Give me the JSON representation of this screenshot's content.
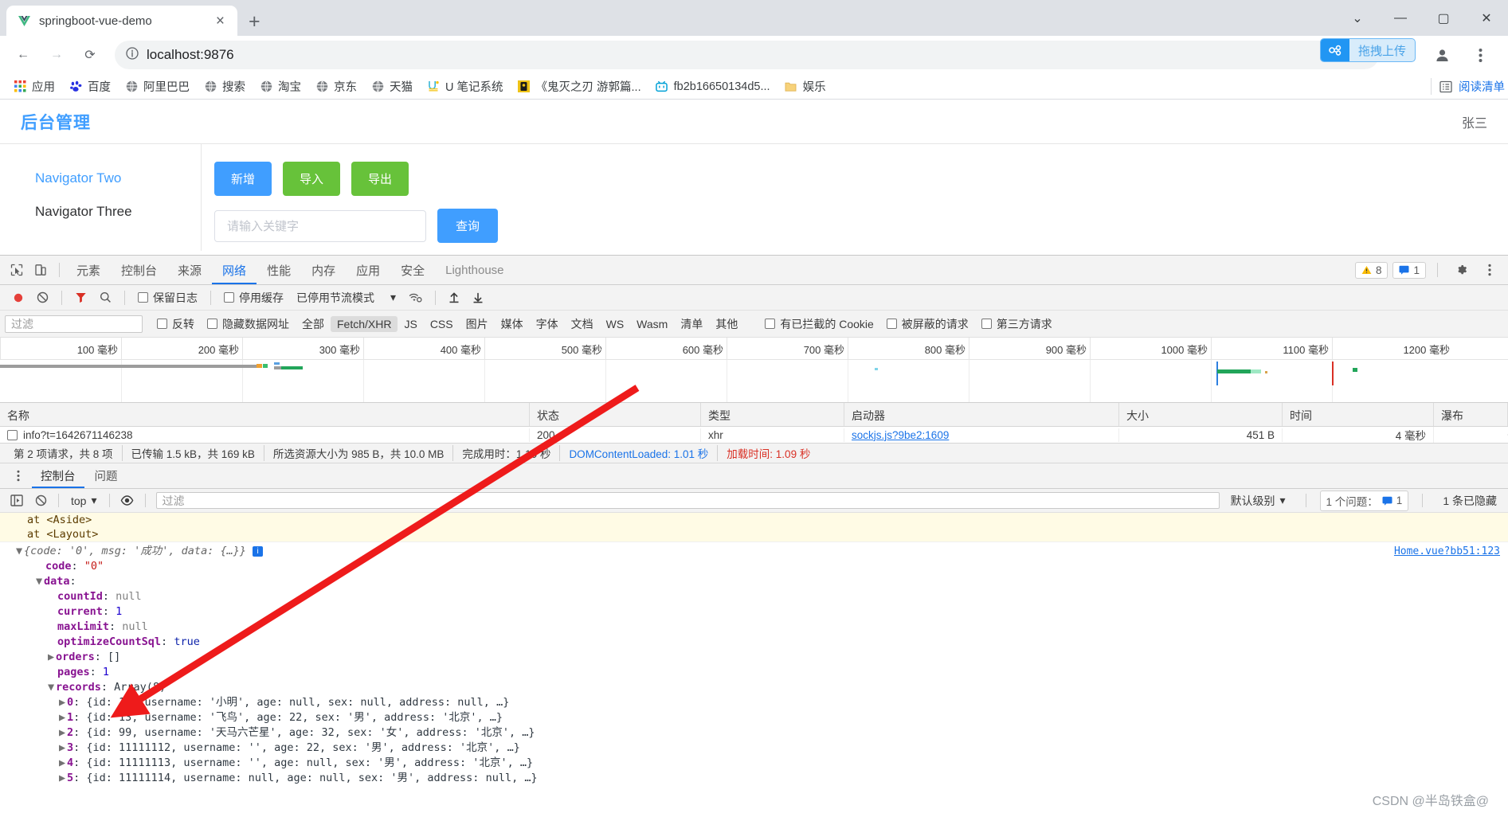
{
  "browser": {
    "tab": {
      "title": "springboot-vue-demo",
      "favicon": "vue-logo-icon",
      "close": "×"
    },
    "new_tab": "+",
    "window_controls": {
      "more": "⌄",
      "minimize": "—",
      "maximize": "▢",
      "close": "✕"
    },
    "url": "localhost:9876",
    "nav": {
      "back": "←",
      "forward": "→",
      "reload": "⟳"
    },
    "drag_upload_label": "拖拽上传",
    "bookmarks": [
      {
        "label": "应用",
        "icon": "apps-grid-icon"
      },
      {
        "label": "百度",
        "icon": "baidu-icon"
      },
      {
        "label": "阿里巴巴",
        "icon": "globe-icon"
      },
      {
        "label": "搜索",
        "icon": "globe-icon"
      },
      {
        "label": "淘宝",
        "icon": "globe-icon"
      },
      {
        "label": "京东",
        "icon": "globe-icon"
      },
      {
        "label": "天猫",
        "icon": "globe-icon"
      },
      {
        "label": "U 笔记系统",
        "icon": "u-note-icon"
      },
      {
        "label": "《鬼灭之刃 游郭篇...",
        "icon": "anime-icon"
      },
      {
        "label": "fb2b16650134d5...",
        "icon": "bilibili-icon"
      },
      {
        "label": "娱乐",
        "icon": "folder-icon"
      }
    ],
    "bookmarks_right": {
      "label": "阅读清单",
      "icon": "reading-list-icon"
    }
  },
  "app": {
    "logo": "后台管理",
    "user": "张三",
    "sidebar": [
      {
        "label": "Navigator Two",
        "active": true
      },
      {
        "label": "Navigator Three",
        "active": false
      }
    ],
    "buttons": [
      {
        "label": "新增",
        "type": "primary"
      },
      {
        "label": "导入",
        "type": "success"
      },
      {
        "label": "导出",
        "type": "success"
      }
    ],
    "search": {
      "placeholder": "请输入关键字",
      "value": "",
      "button": "查询"
    }
  },
  "devtools": {
    "panel_tabs": [
      {
        "label": "元素",
        "active": false
      },
      {
        "label": "控制台",
        "active": false
      },
      {
        "label": "来源",
        "active": false
      },
      {
        "label": "网络",
        "active": true
      },
      {
        "label": "性能",
        "active": false
      },
      {
        "label": "内存",
        "active": false
      },
      {
        "label": "应用",
        "active": false
      },
      {
        "label": "安全",
        "active": false
      },
      {
        "label": "Lighthouse",
        "active": false,
        "gray": true
      }
    ],
    "badges": {
      "warnings": "8",
      "messages": "1"
    },
    "network_toolbar": {
      "record_icon": "record-circle-icon",
      "clear_icon": "clear-icon",
      "filter_icon": "funnel-icon",
      "search_icon": "search-icon",
      "preserve_log": "保留日志",
      "disable_cache": "停用缓存",
      "throttling": "已停用节流模式",
      "import_icon": "upload-arrow-icon",
      "export_icon": "download-arrow-icon",
      "wifi_icon": "wifi-gear-icon"
    },
    "filter_bar": {
      "placeholder": "过滤",
      "invert": "反转",
      "hide_data_urls": "隐藏数据网址",
      "types": [
        {
          "label": "全部",
          "active": false
        },
        {
          "label": "Fetch/XHR",
          "active": true
        },
        {
          "label": "JS",
          "active": false
        },
        {
          "label": "CSS",
          "active": false
        },
        {
          "label": "图片",
          "active": false
        },
        {
          "label": "媒体",
          "active": false
        },
        {
          "label": "字体",
          "active": false
        },
        {
          "label": "文档",
          "active": false
        },
        {
          "label": "WS",
          "active": false
        },
        {
          "label": "Wasm",
          "active": false
        },
        {
          "label": "清单",
          "active": false
        },
        {
          "label": "其他",
          "active": false
        }
      ],
      "blocked_cookies": "有已拦截的 Cookie",
      "blocked_requests": "被屏蔽的请求",
      "third_party": "第三方请求"
    },
    "timeline_ticks": [
      "100 毫秒",
      "200 毫秒",
      "300 毫秒",
      "400 毫秒",
      "500 毫秒",
      "600 毫秒",
      "700 毫秒",
      "800 毫秒",
      "900 毫秒",
      "1000 毫秒",
      "1100 毫秒",
      "1200 毫秒"
    ],
    "table": {
      "columns": [
        "名称",
        "状态",
        "类型",
        "启动器",
        "大小",
        "时间",
        "瀑布"
      ],
      "rows": [
        {
          "name": "info?t=1642671146238",
          "status": "200",
          "type": "xhr",
          "initiator": "sockjs.js?9be2:1609",
          "size": "451 B",
          "time": "4 毫秒"
        }
      ]
    },
    "summary": [
      {
        "text": "第 2 项请求，共 8 项",
        "style": "plain"
      },
      {
        "text": "已传输 1.5 kB，共 169 kB",
        "style": "plain"
      },
      {
        "text": "所选资源大小为 985 B，共 10.0 MB",
        "style": "plain"
      },
      {
        "text": "完成用时：1.10 秒",
        "style": "plain"
      },
      {
        "text": "DOMContentLoaded: 1.01 秒",
        "style": "blue"
      },
      {
        "text": "加载时间: 1.09 秒",
        "style": "red"
      }
    ],
    "drawer_tabs": [
      {
        "label": "控制台",
        "active": true
      },
      {
        "label": "问题",
        "active": false
      }
    ],
    "console_toolbar": {
      "context": "top",
      "filter_placeholder": "过滤",
      "level": "默认级别",
      "issues": "1 个问题：",
      "issues_count": "1",
      "hidden": "1 条已隐藏"
    }
  },
  "console": {
    "warn_lines": [
      "at <Aside>",
      "at <Layout>"
    ],
    "summary_line": "{code: '0', msg: '成功', data: {…}}",
    "source_link": "Home.vue?bb51:123",
    "tree": [
      {
        "indent": 1,
        "tri": "",
        "key": "code",
        "sep": ": ",
        "val": "\"0\"",
        "valType": "str"
      },
      {
        "indent": 1,
        "tri": "▼",
        "key": "data",
        "sep": ":",
        "val": "",
        "valType": "plain"
      },
      {
        "indent": 2,
        "tri": "",
        "key": "countId",
        "sep": ": ",
        "val": "null",
        "valType": "null"
      },
      {
        "indent": 2,
        "tri": "",
        "key": "current",
        "sep": ": ",
        "val": "1",
        "valType": "num"
      },
      {
        "indent": 2,
        "tri": "",
        "key": "maxLimit",
        "sep": ": ",
        "val": "null",
        "valType": "null"
      },
      {
        "indent": 2,
        "tri": "",
        "key": "optimizeCountSql",
        "sep": ": ",
        "val": "true",
        "valType": "bool"
      },
      {
        "indent": 2,
        "tri": "▶",
        "key": "orders",
        "sep": ": ",
        "val": "[]",
        "valType": "plain"
      },
      {
        "indent": 2,
        "tri": "",
        "key": "pages",
        "sep": ": ",
        "val": "1",
        "valType": "num"
      },
      {
        "indent": 2,
        "tri": "▼",
        "key": "records",
        "sep": ": ",
        "val": "Array(8)",
        "valType": "plain"
      }
    ],
    "records": [
      {
        "idx": "0",
        "text": "{id: 10, username: '小明', age: null, sex: null, address: null, …}"
      },
      {
        "idx": "1",
        "text": "{id: 13, username: '飞鸟', age: 22, sex: '男', address: '北京', …}"
      },
      {
        "idx": "2",
        "text": "{id: 99, username: '天马六芒星', age: 32, sex: '女', address: '北京', …}"
      },
      {
        "idx": "3",
        "text": "{id: 11111112, username: '', age: 22, sex: '男', address: '北京', …}"
      },
      {
        "idx": "4",
        "text": "{id: 11111113, username: '', age: null, sex: '男', address: '北京', …}"
      },
      {
        "idx": "5",
        "text": "{id: 11111114, username: null, age: null, sex: '男', address: null, …}"
      }
    ]
  },
  "watermark": "CSDN @半岛铁盒@"
}
